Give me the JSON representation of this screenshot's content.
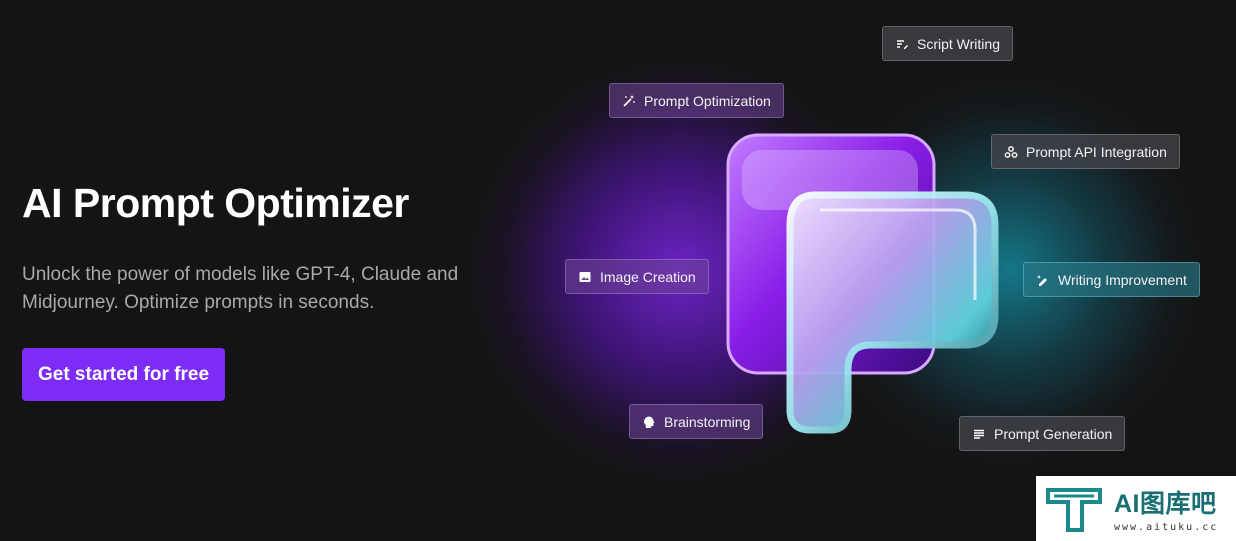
{
  "hero": {
    "title": "AI Prompt Optimizer",
    "subtitle": "Unlock the power of models like GPT-4, Claude and Midjourney. Optimize prompts in seconds.",
    "cta_label": "Get started for free"
  },
  "colors": {
    "background": "#141414",
    "accent": "#7c2cf5",
    "glow_purple": "#8a28ff",
    "glow_cyan": "#14c8e6"
  },
  "feature_chips": [
    {
      "label": "Script Writing",
      "icon": "script-edit-icon"
    },
    {
      "label": "Prompt Optimization",
      "icon": "magic-wand-icon"
    },
    {
      "label": "Prompt API Integration",
      "icon": "api-webhook-icon"
    },
    {
      "label": "Image Creation",
      "icon": "image-icon"
    },
    {
      "label": "Writing Improvement",
      "icon": "edit-sparkle-icon"
    },
    {
      "label": "Brainstorming",
      "icon": "brain-head-icon"
    },
    {
      "label": "Prompt Generation",
      "icon": "text-lines-icon"
    }
  ],
  "watermark": {
    "brand": "AI图库吧",
    "url": "www.aituku.cc"
  }
}
